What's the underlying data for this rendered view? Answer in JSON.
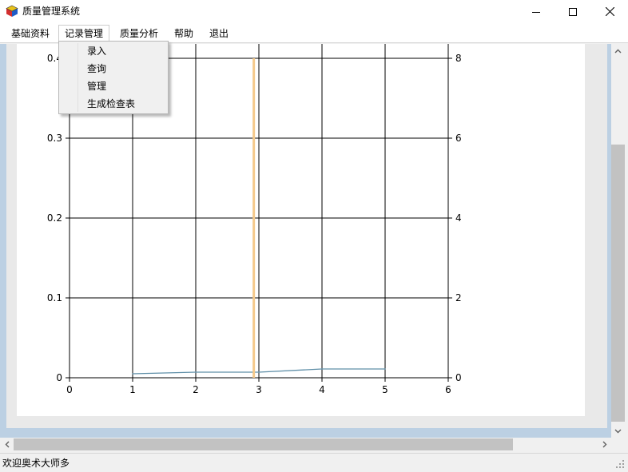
{
  "window": {
    "title": "质量管理系统",
    "icon": "app-cube-icon"
  },
  "menu": {
    "items": [
      {
        "label": "基础资料"
      },
      {
        "label": "记录管理"
      },
      {
        "label": "质量分析"
      },
      {
        "label": "帮助"
      },
      {
        "label": "退出"
      }
    ],
    "open_index": 1,
    "dropdown": [
      {
        "label": "录入"
      },
      {
        "label": "查询"
      },
      {
        "label": "管理"
      },
      {
        "label": "生成检查表"
      }
    ]
  },
  "status": {
    "text": "欢迎奥术大师多"
  },
  "scroll": {
    "vertical_position": 0.25,
    "horizontal_position": 0.0
  },
  "colors": {
    "line_series": "#5f8fa8",
    "bar_series": "#f5c98a",
    "gridline": "#000000",
    "content_border": "#bcd0e3"
  },
  "chart_data": {
    "type": "line",
    "title": "",
    "xlabel": "",
    "ylabel": "",
    "x_ticks": [
      "0",
      "1",
      "2",
      "3",
      "4",
      "5",
      "6"
    ],
    "y_ticks": [
      "0",
      "0.1",
      "0.2",
      "0.3",
      "0.4"
    ],
    "y2_ticks": [
      "0",
      "2",
      "4",
      "6",
      "8"
    ],
    "xlim": [
      0,
      6
    ],
    "ylim": [
      0,
      0.4
    ],
    "y2lim": [
      0,
      8
    ],
    "grid": true,
    "series": [
      {
        "axis": "y",
        "kind": "line",
        "x": [
          1,
          2,
          3,
          4,
          5
        ],
        "y": [
          0.005,
          0.007,
          0.007,
          0.011,
          0.011
        ]
      },
      {
        "axis": "y2",
        "kind": "bar",
        "x": [
          2.92
        ],
        "y": [
          8
        ]
      }
    ]
  }
}
